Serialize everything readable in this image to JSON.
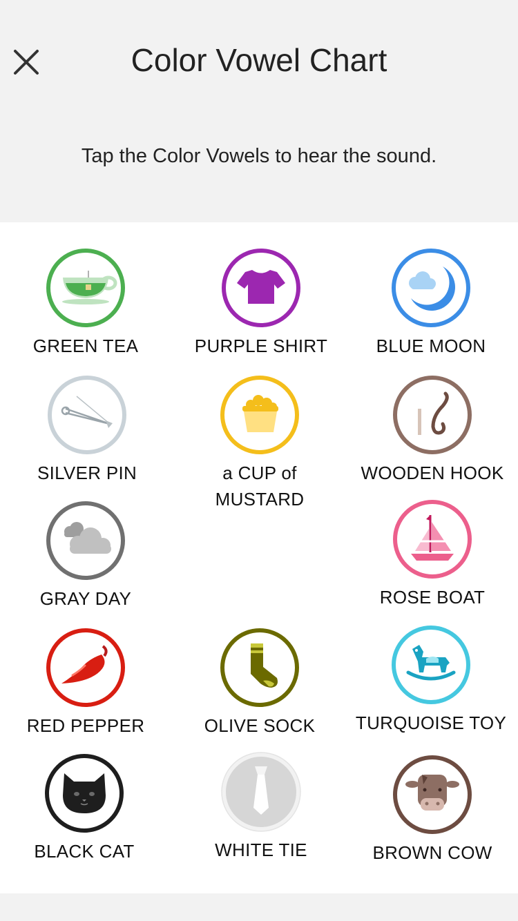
{
  "header": {
    "title": "Color Vowel Chart",
    "subtitle": "Tap the Color Vowels to hear the sound."
  },
  "vowels": [
    {
      "label": "GREEN TEA",
      "color": "#4caf50",
      "icon": "teacup-icon"
    },
    {
      "label": "PURPLE SHIRT",
      "color": "#9c27b0",
      "icon": "shirt-icon"
    },
    {
      "label": "BLUE MOON",
      "color": "#3b8de6",
      "icon": "moon-icon"
    },
    {
      "label": "SILVER PIN",
      "color": "#c9d2d8",
      "icon": "safety-pin-icon"
    },
    {
      "label": "a CUP of",
      "label2": "MUSTARD",
      "color": "#f4be1b",
      "icon": "mustard-cup-icon"
    },
    {
      "label": "WOODEN HOOK",
      "color": "#8d6e63",
      "icon": "hook-icon"
    },
    {
      "label": "GRAY DAY",
      "color": "#707070",
      "icon": "cloud-icon"
    },
    {
      "label": "ROSE BOAT",
      "color": "#ec5f8c",
      "icon": "sailboat-icon"
    },
    {
      "label": "RED PEPPER",
      "color": "#d81e12",
      "icon": "pepper-icon"
    },
    {
      "label": "OLIVE SOCK",
      "color": "#6b6a00",
      "icon": "sock-icon"
    },
    {
      "label": "TURQUOISE TOY",
      "color": "#45c8e0",
      "icon": "rocking-horse-icon"
    },
    {
      "label": "BLACK CAT",
      "color": "#1e1e1e",
      "icon": "cat-icon"
    },
    {
      "label": "WHITE TIE",
      "color": "#e8e8e8",
      "icon": "tie-icon"
    },
    {
      "label": "BROWN COW",
      "color": "#6d4c41",
      "icon": "cow-icon"
    }
  ]
}
